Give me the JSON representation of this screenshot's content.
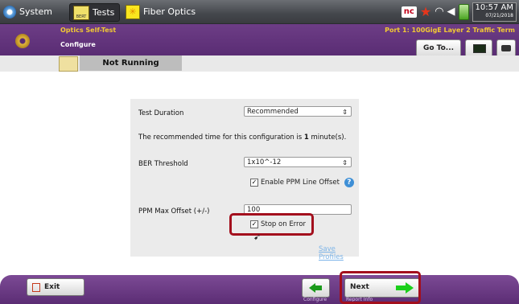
{
  "topbar": {
    "system_label": "System",
    "tests_label": "Tests",
    "tests_icon_text": "BERT",
    "fiber_label": "Fiber Optics",
    "nc_badge": "nc",
    "time": "10:57 AM",
    "date": "07/21/2018"
  },
  "header": {
    "title": "Optics Self-Test",
    "subtitle": "Configure",
    "port": "Port 1: 100GigE Layer 2 Traffic Term",
    "goto_label": "Go To..."
  },
  "status": {
    "label": "Not Running"
  },
  "config": {
    "test_duration_label": "Test Duration",
    "test_duration_value": "Recommended",
    "recommended_prefix": "The recommended time for this configuration is ",
    "recommended_value": "1",
    "recommended_suffix": " minute(s).",
    "ber_label": "BER Threshold",
    "ber_value": "1x10^-12",
    "ppm_line_label": "Enable PPM Line Offset",
    "ppm_line_checked": true,
    "ppm_max_label": "PPM Max Offset (+/-)",
    "ppm_max_value": "100",
    "stop_on_error_label": "Stop on Error",
    "stop_on_error_checked": true,
    "save_profiles_label": "Save Profiles"
  },
  "bottom": {
    "exit_label": "Exit",
    "back_sublabel": "Configure",
    "next_label": "Next",
    "next_sublabel": "Report Info"
  },
  "colors": {
    "header_purple": "#582b72",
    "accent_yellow": "#f2c933",
    "highlight_red": "#a30f1d",
    "next_arrow_green": "#1bcf1b"
  }
}
